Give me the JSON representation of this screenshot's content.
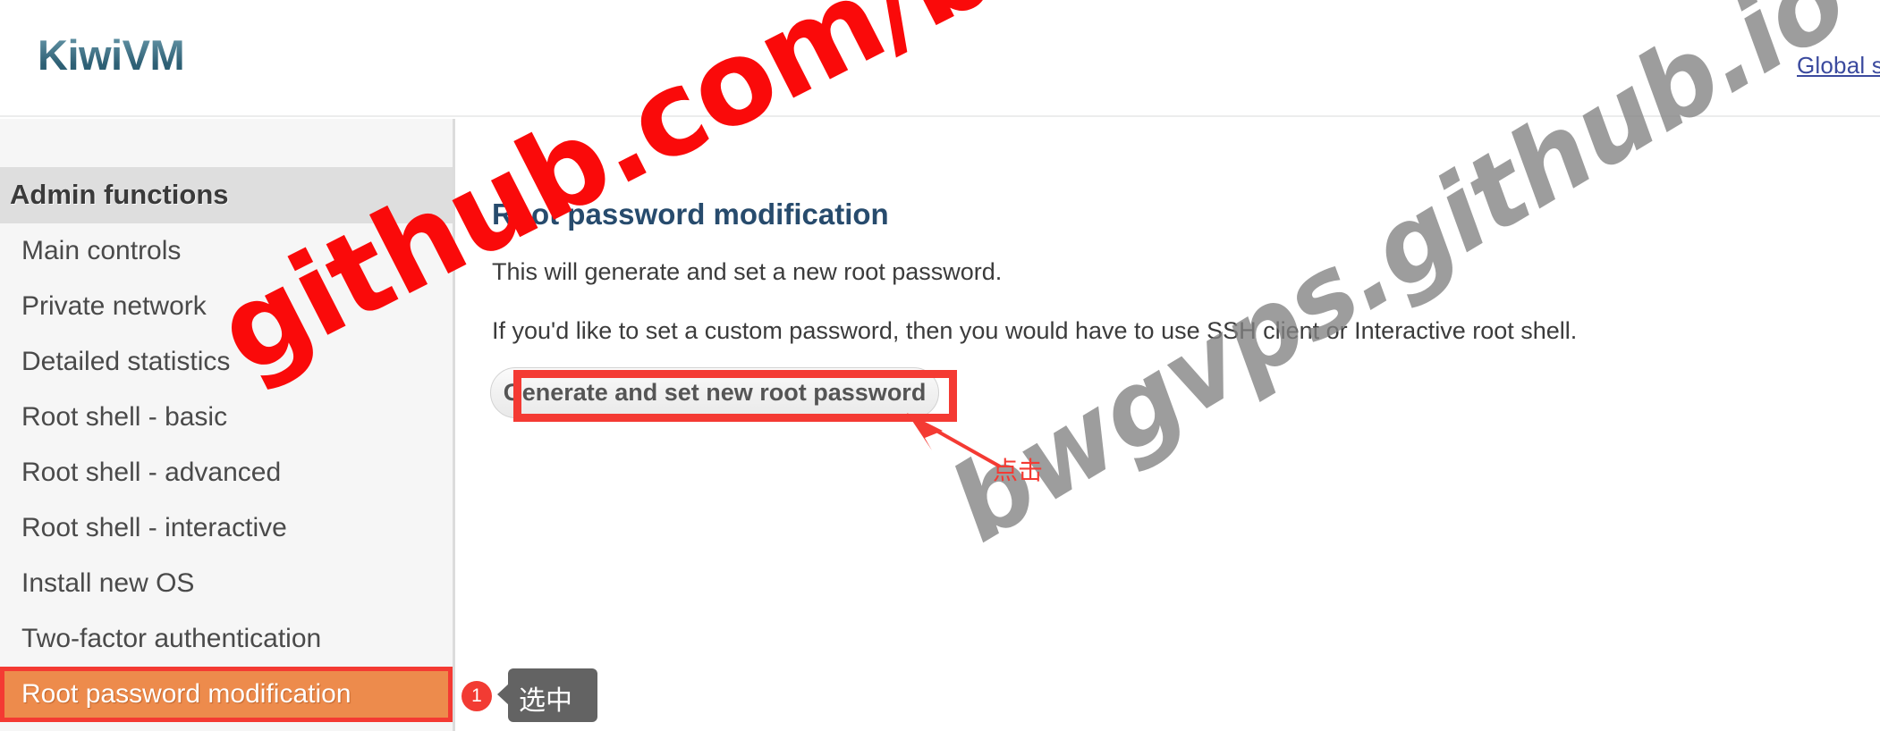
{
  "header": {
    "brand": "KiwiVM",
    "global_settings_link": "Global s"
  },
  "sidebar": {
    "heading": "Admin functions",
    "items": [
      {
        "label": "Main controls",
        "active": false
      },
      {
        "label": "Private network",
        "active": false
      },
      {
        "label": "Detailed statistics",
        "active": false
      },
      {
        "label": "Root shell - basic",
        "active": false
      },
      {
        "label": "Root shell - advanced",
        "active": false
      },
      {
        "label": "Root shell - interactive",
        "active": false
      },
      {
        "label": "Install new OS",
        "active": false
      },
      {
        "label": "Two-factor authentication",
        "active": false
      },
      {
        "label": "Root password modification",
        "active": true
      }
    ]
  },
  "annotations": {
    "step_badge": "1",
    "tooltip_text": "选中",
    "click_label": "点击"
  },
  "main": {
    "title": "Root password modification",
    "paragraph_1": "This will generate and set a new root password.",
    "paragraph_2": "If you'd like to set a custom password, then you would have to use SSH client or Interactive root shell.",
    "generate_button": "Generate and set new root password"
  },
  "watermarks": {
    "red": "github.com/bwgvps",
    "gray": "bwgvps.github.io"
  },
  "colors": {
    "brand": "#34687d",
    "link": "#3b4a9e",
    "sidebar_bg": "#f6f6f6",
    "sidebar_heading_bg": "#dedede",
    "active_item_bg": "#ed8b4c",
    "annotation_red": "#f43a33",
    "badge_red": "#f23b33",
    "tooltip_bg": "#636363",
    "title_navy": "#274b6d",
    "watermark_red": "#fa0a0a",
    "watermark_gray": "#828282"
  }
}
